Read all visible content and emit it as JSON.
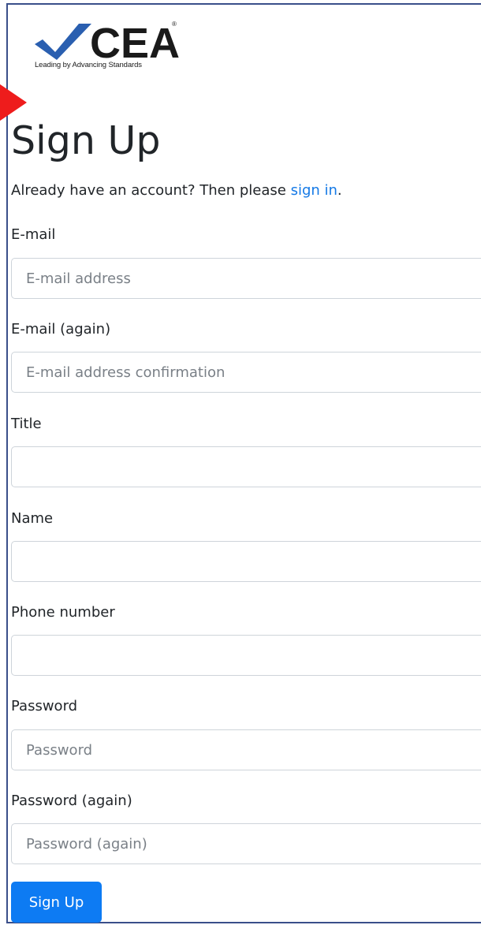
{
  "logo": {
    "name": "CEA",
    "registered_mark": "®",
    "tagline": "Leading by Advancing Standards",
    "checkmark_color": "#2a5fb0",
    "text_color": "#1a1a1a"
  },
  "page": {
    "title": "Sign Up",
    "subtitle_prefix": "Already have an account? Then please ",
    "signin_link": "sign in",
    "subtitle_suffix": ".",
    "link_color": "#1479e6"
  },
  "form": {
    "email": {
      "label": "E-mail",
      "placeholder": "E-mail address",
      "value": ""
    },
    "email_again": {
      "label": "E-mail (again)",
      "placeholder": "E-mail address confirmation",
      "value": ""
    },
    "title": {
      "label": "Title",
      "placeholder": "",
      "value": ""
    },
    "name": {
      "label": "Name",
      "placeholder": "",
      "value": ""
    },
    "phone": {
      "label": "Phone number",
      "placeholder": "",
      "value": ""
    },
    "password": {
      "label": "Password",
      "placeholder": "Password",
      "value": ""
    },
    "password_again": {
      "label": "Password (again)",
      "placeholder": "Password (again)",
      "value": ""
    },
    "submit_label": "Sign Up",
    "submit_color": "#0d7bf3"
  },
  "icons": {
    "logo_check": "checkmark-icon",
    "pointer": "arrow-marker-icon"
  }
}
